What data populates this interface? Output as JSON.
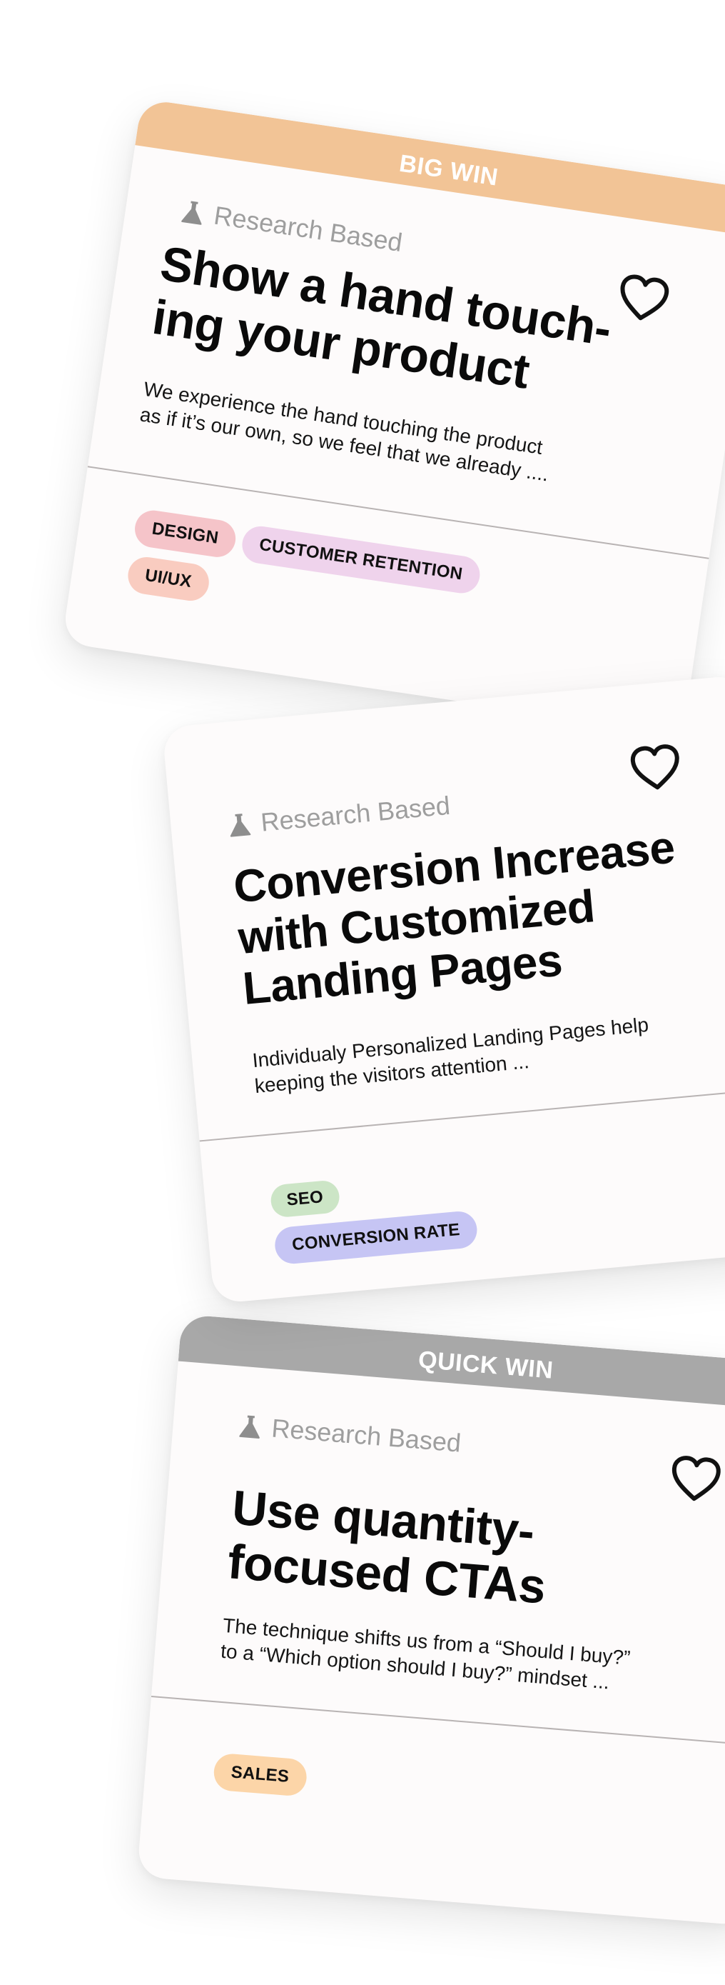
{
  "colors": {
    "big_win_banner": "#f2c496",
    "quick_win_banner": "#a8a8a8",
    "card_bg": "#fdfbfb",
    "research_text": "#9e9e9e",
    "tag_design": "#f5c4c9",
    "tag_customer_retention": "#efd3ec",
    "tag_uiux": "#f9ccc0",
    "tag_seo": "#cce5c6",
    "tag_conversion_rate": "#c6c5f4",
    "tag_sales": "#fcd5a8"
  },
  "cards": [
    {
      "banner": "BIG WIN",
      "research_label": "Research Based",
      "research_icon": "flask-icon",
      "title": "Show a hand touch-ing your product",
      "title_lines": [
        "Show a hand touch-",
        "ing your product"
      ],
      "description_lines": [
        "We experience the hand touching the product",
        "as if it’s our own, so we feel that we already ...."
      ],
      "favorite_icon": "heart-icon",
      "tags": [
        "DESIGN",
        "CUSTOMER RETENTION",
        "UI/UX"
      ]
    },
    {
      "banner": "",
      "research_label": "Research Based",
      "research_icon": "flask-icon",
      "title_lines": [
        "Conversion Increase",
        "with Customized",
        "Landing Pages"
      ],
      "description_lines": [
        "Individualy Personalized Landing Pages help",
        "keeping the visitors attention ..."
      ],
      "favorite_icon": "heart-icon",
      "tags": [
        "SEO",
        "CONVERSION RATE"
      ]
    },
    {
      "banner": "QUICK WIN",
      "research_label": "Research Based",
      "research_icon": "flask-icon",
      "title_lines": [
        "Use quantity-",
        "focused CTAs"
      ],
      "description_lines": [
        "The technique shifts us from a “Should I buy?”",
        "to a “Which option should I buy?” mindset ..."
      ],
      "favorite_icon": "heart-icon",
      "tags": [
        "SALES"
      ]
    }
  ]
}
